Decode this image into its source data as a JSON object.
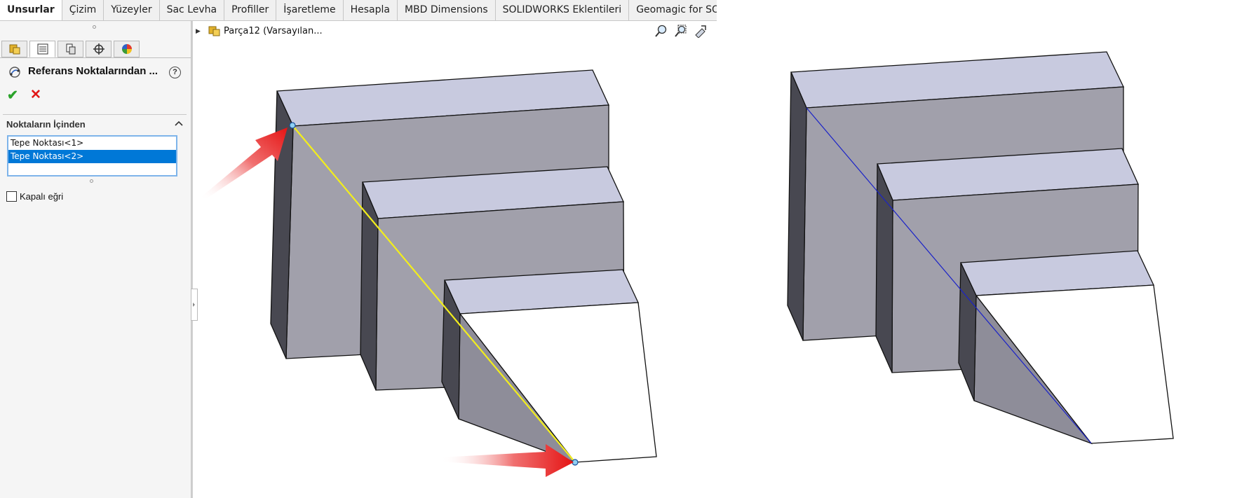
{
  "tabs": [
    {
      "label": "Unsurlar",
      "active": true
    },
    {
      "label": "Çizim"
    },
    {
      "label": "Yüzeyler"
    },
    {
      "label": "Sac Levha"
    },
    {
      "label": "Profiller"
    },
    {
      "label": "İşaretleme"
    },
    {
      "label": "Hesapla"
    },
    {
      "label": "MBD Dimensions"
    },
    {
      "label": "SOLIDWORKS Eklentileri"
    },
    {
      "label": "Geomagic for SOLIDWORKS"
    }
  ],
  "panel": {
    "property_tabs": [
      "feature-manager-icon",
      "property-manager-icon",
      "configuration-manager-icon",
      "dimxpert-icon",
      "display-manager-icon"
    ],
    "title": "Referans Noktalarından ...",
    "help": "?",
    "ok": "✔",
    "cancel": "✕",
    "section_title": "Noktaların İçinden",
    "points": [
      "Tepe Noktası<1>",
      "Tepe Noktası<2>"
    ],
    "selected_point_index": 1,
    "closed_curve_label": "Kapalı eğri",
    "closed_curve_checked": false
  },
  "tree": {
    "part_label": "Parça12  (Varsayılan..."
  },
  "hud": [
    "zoom-to-fit-icon",
    "zoom-to-area-icon",
    "previous-view-icon"
  ],
  "colors": {
    "top_face": "#c8cadf",
    "front_face": "#a1a0ab",
    "side_face": "#484851",
    "preview_line": "#f2ee1c",
    "result_line": "#1a22c8",
    "arrow": "#e51414",
    "selection": "#0078d7"
  }
}
